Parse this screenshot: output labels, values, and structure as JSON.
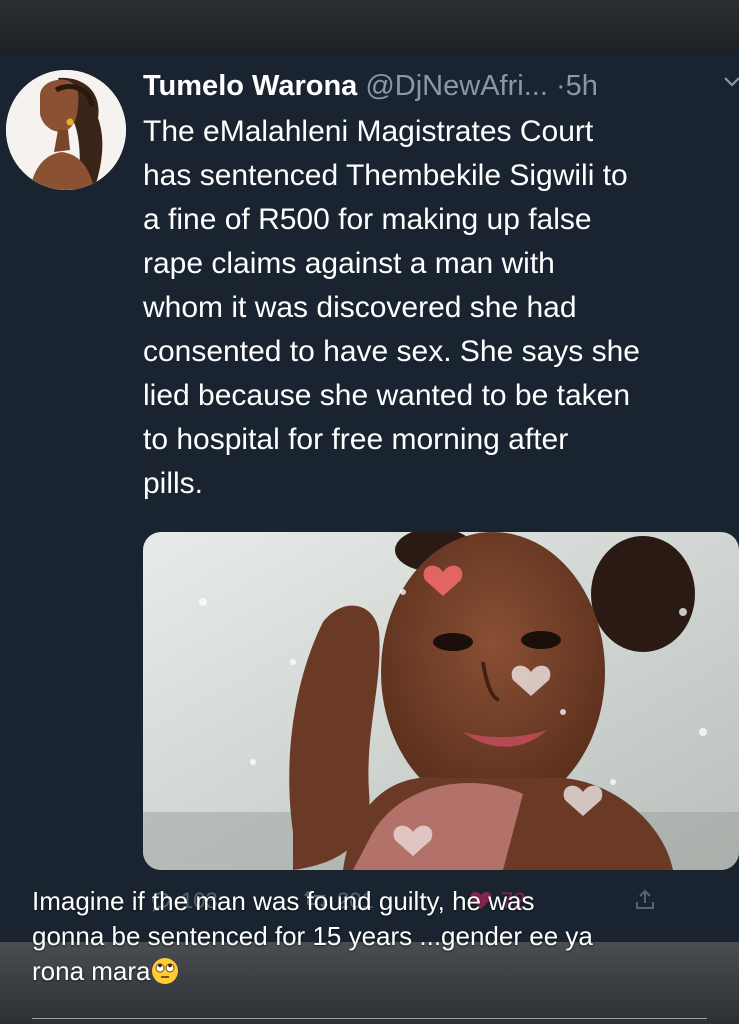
{
  "tweet": {
    "author_name": "Tumelo Warona",
    "author_handle": "@DjNewAfri...",
    "separator": "·",
    "time": "5h",
    "text_lines": [
      "The eMalahleni Magistrates Court",
      "has sentenced Thembekile Sigwili to",
      "a fine of R500 for making up false",
      "rape claims against a man with",
      "whom it was discovered she had",
      "consented to have sex. She says she",
      "lied because she wanted to be taken",
      "to hospital for free morning after",
      "pills."
    ],
    "actions": {
      "reply_count": "103",
      "retweet_count": "201",
      "like_count": "72"
    }
  },
  "caption": {
    "lines": [
      "Imagine if the man was found guilty, he was",
      "gonna be sentenced for 15 years ...gender ee ya",
      "rona mara"
    ],
    "emoji": "face-with-rolling-eyes"
  },
  "colors": {
    "tweet_background": "#192430",
    "text": "#ffffff",
    "secondary_text": "#8899a6",
    "like": "#e0245e",
    "emoji": "#ffcc33"
  }
}
